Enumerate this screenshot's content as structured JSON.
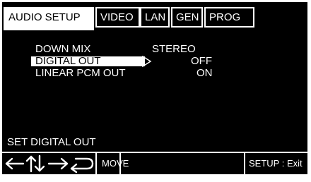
{
  "tabs": [
    {
      "label": "AUDIO SETUP",
      "active": true
    },
    {
      "label": "VIDEO",
      "active": false
    },
    {
      "label": "LAN",
      "active": false
    },
    {
      "label": "GEN",
      "active": false
    },
    {
      "label": "PROG",
      "active": false
    }
  ],
  "menu": {
    "items": [
      {
        "label": "DOWN MIX",
        "value": "STEREO"
      },
      {
        "label": "DIGITAL OUT",
        "value": "OFF",
        "selected": true
      },
      {
        "label": "LINEAR PCM OUT",
        "value": "ON"
      }
    ]
  },
  "hint_text": "SET DIGITAL OUT",
  "footer": {
    "move_label": "MOVE",
    "exit_label": "SETUP : Exit"
  },
  "icons": [
    "arrow-left-icon",
    "arrow-up-down-icon",
    "arrow-right-icon",
    "return-icon",
    "select-pointer-icon"
  ]
}
